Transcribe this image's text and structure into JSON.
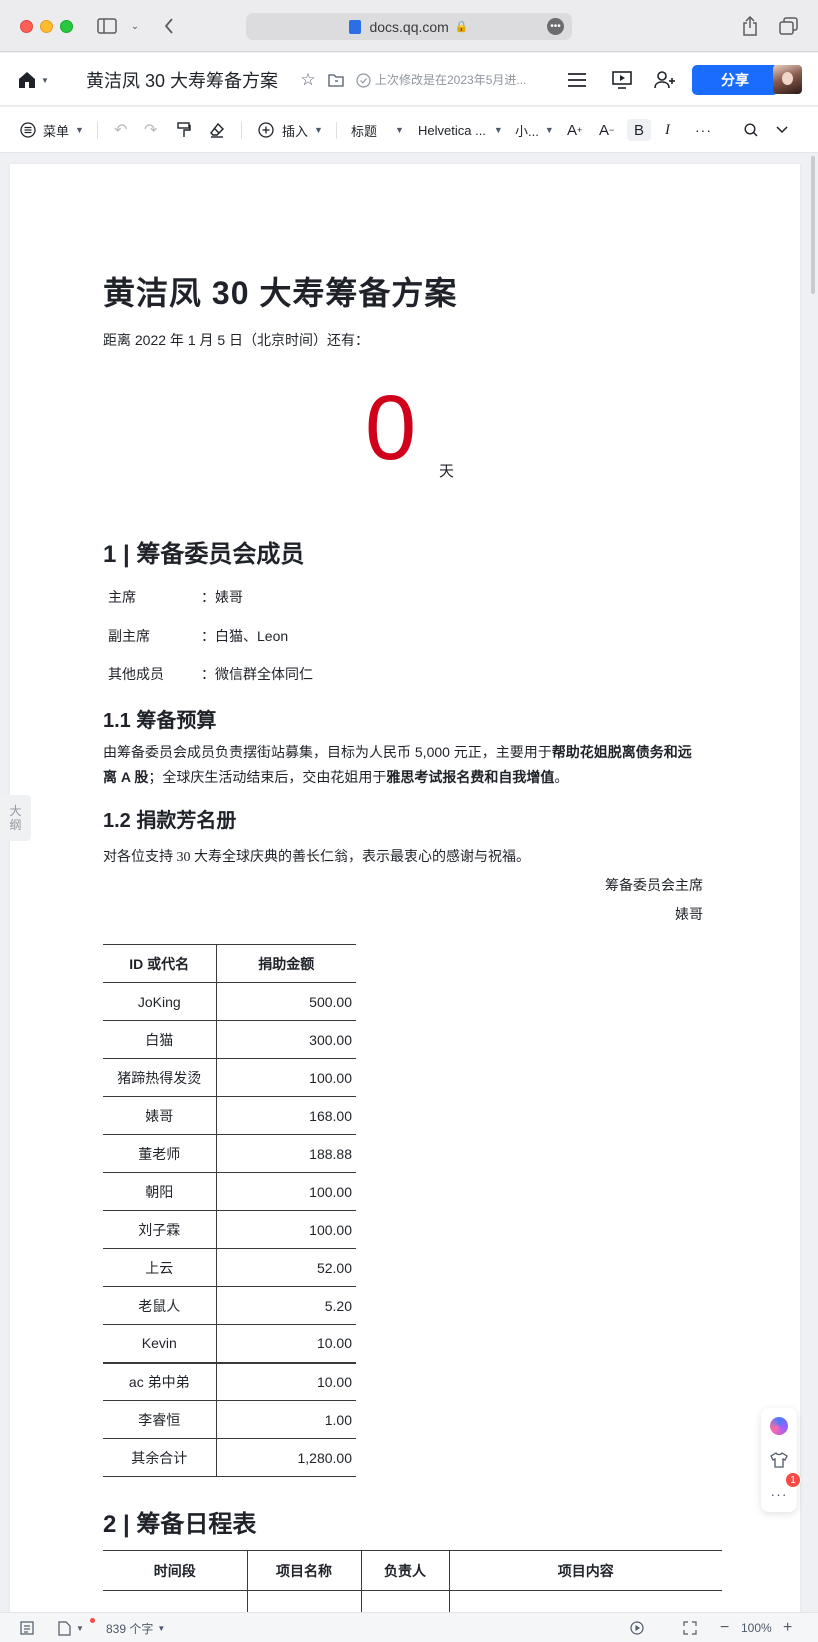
{
  "browser": {
    "url": "docs.qq.com"
  },
  "doc_header": {
    "title": "黄洁凤 30 大寿筹备方案",
    "last_edit": "上次修改是在2023年5月进...",
    "share_label": "分享"
  },
  "toolbar": {
    "menu_label": "菜单",
    "insert_label": "插入",
    "style_label": "标题",
    "font_label": "Helvetica ...",
    "size_label": "小..."
  },
  "doc": {
    "title": "黄洁凤 30 大寿筹备方案",
    "countdown_label": "距离 2022 年 1 月 5 日（北京时间）还有：",
    "countdown_value": "0",
    "countdown_unit": "天",
    "section1_title": "1 | 筹备委员会成员",
    "members": [
      {
        "role": "主席",
        "colon": "：",
        "name": "婊哥"
      },
      {
        "role": "副主席",
        "colon": "：",
        "name": "白猫、Leon"
      },
      {
        "role": "其他成员",
        "colon": "：",
        "name": "微信群全体同仁"
      }
    ],
    "budget_title": "1.1 筹备预算",
    "budget_p1": "由筹备委员会成员负责摆街站募集，目标为人民币 5,000 元正，主要用于",
    "budget_b1": "帮助花姐脱离债务和远离 A 股",
    "budget_p2": "；全球庆生活动结束后，交由花姐用于",
    "budget_b2": "雅思考试报名费和自我增值",
    "budget_p3": "。",
    "donor_title": "1.2 捐款芳名册",
    "thanks_text": "对各位支持 30 大寿全球庆典的善长仁翁，表示最衷心的感谢与祝福。",
    "signature_role": "筹备委员会主席",
    "signature_name": "婊哥",
    "donor_headers": [
      "ID 或代名",
      "捐助金额"
    ],
    "donors": [
      {
        "id": "JoKing",
        "amount": "500.00"
      },
      {
        "id": "白猫",
        "amount": "300.00"
      },
      {
        "id": "猪蹄热得发烫",
        "amount": "100.00"
      },
      {
        "id": "婊哥",
        "amount": "168.00"
      },
      {
        "id": "董老师",
        "amount": "188.88"
      },
      {
        "id": "朝阳",
        "amount": "100.00"
      },
      {
        "id": "刘子霖",
        "amount": "100.00"
      },
      {
        "id": "上云",
        "amount": "52.00"
      },
      {
        "id": "老鼠人",
        "amount": "5.20"
      },
      {
        "id": "Kevin",
        "amount": "10.00"
      },
      {
        "id": "ac 弟中弟",
        "amount": "10.00"
      },
      {
        "id": "李睿恒",
        "amount": "1.00"
      },
      {
        "id": "其余合计",
        "amount": "1,280.00"
      }
    ],
    "section2_title": "2 | 筹备日程表",
    "schedule_headers": [
      "时间段",
      "项目名称",
      "负责人",
      "项目内容"
    ]
  },
  "outline_tab": {
    "line1": "大",
    "line2": "纲"
  },
  "float_panel": {
    "badge": "1"
  },
  "status_bar": {
    "word_count": "839 个字",
    "zoom": "100%"
  }
}
